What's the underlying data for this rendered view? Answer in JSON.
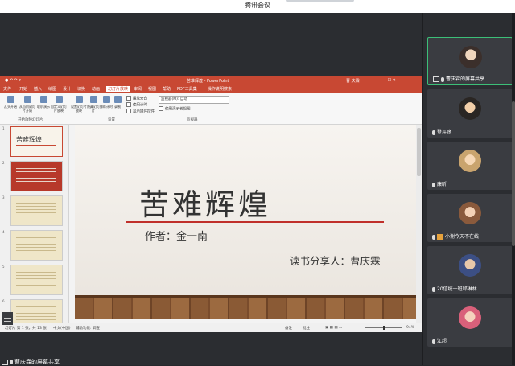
{
  "app": {
    "title": "腾讯会议"
  },
  "ppt": {
    "window_title": "苦难辉煌 - PowerPoint",
    "user": "曹 庆霖",
    "tabs": [
      "文件",
      "开始",
      "插入",
      "绘图",
      "设计",
      "切换",
      "动画",
      "幻灯片放映",
      "审阅",
      "视图",
      "帮助",
      "PDF工具集"
    ],
    "active_tab": "幻灯片放映",
    "tell_me": "操作说明搜索",
    "ribbon": {
      "buttons": [
        "从头开始",
        "从当前幻灯片开始",
        "联机演示",
        "自定义幻灯片放映",
        "设置幻灯片放映",
        "隐藏幻灯片",
        "排练计时",
        "录制"
      ],
      "checks": [
        "播放旁白",
        "使用计时",
        "显示媒体控件"
      ],
      "monitor_label": "监视器(M):",
      "monitor_value": "自动",
      "presenter_view": "使用演示者视图",
      "groups": [
        "开始放映幻灯片",
        "设置",
        "监视器"
      ]
    },
    "thumb_numbers": [
      "1",
      "2",
      "3",
      "4",
      "5",
      "6"
    ],
    "thumb_title_mini": "苦难辉煌",
    "slide": {
      "title": "苦难辉煌",
      "author": "作者：金一南",
      "sharer": "读书分享人：曹庆霖"
    },
    "status": {
      "slide_count": "幻灯片 第 1 张，共 13 张",
      "lang": "中文(中国)",
      "accessibility": "辅助功能: 调查",
      "notes": "备注",
      "comments": "批注",
      "zoom": "94%"
    }
  },
  "participants": [
    {
      "name": "曹庆霖的屏幕共享",
      "active": true,
      "sharing": true
    },
    {
      "name": "登斗殇",
      "active": false,
      "sharing": false
    },
    {
      "name": "康昕",
      "active": false,
      "sharing": false
    },
    {
      "name": "小谢今天不在线",
      "active": false,
      "sharing": false
    },
    {
      "name": "20信统一班邱琳林",
      "active": false,
      "sharing": false
    },
    {
      "name": "江超",
      "active": false,
      "sharing": false
    }
  ],
  "bottom_bar": {
    "label": "曹庆霖的屏幕共享"
  },
  "colors": {
    "ppt_accent": "#c84833",
    "active_border": "#3cbf78"
  }
}
